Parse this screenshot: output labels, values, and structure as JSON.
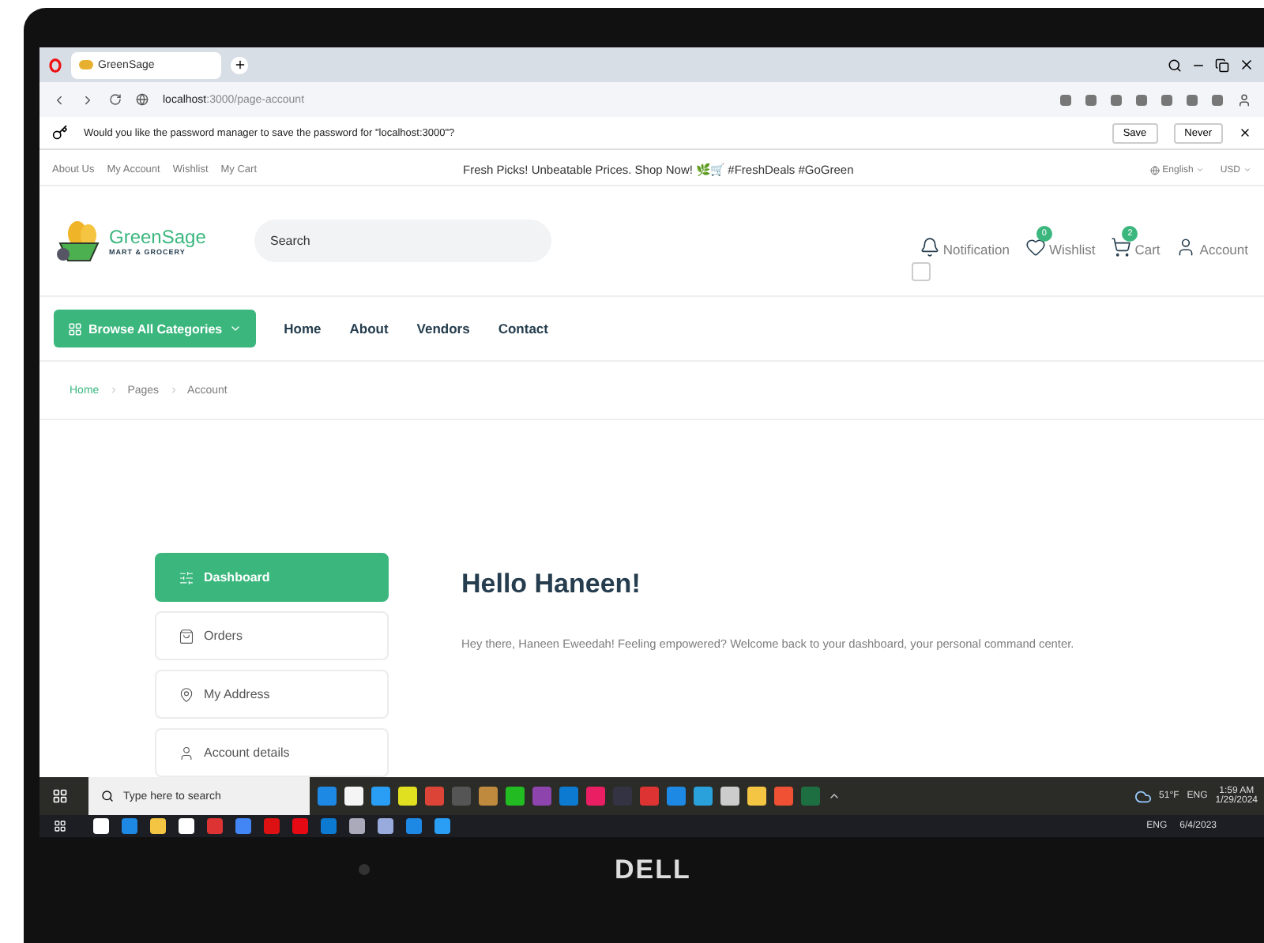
{
  "browser": {
    "tab_title": "GreenSage",
    "address_host": "localhost",
    "address_path": ":3000/page-account"
  },
  "password_prompt": {
    "message": "Would you like the password manager to save the password for \"localhost:3000\"?",
    "buttons": [
      "Save",
      "Never"
    ]
  },
  "topbar": {
    "links": [
      "About Us",
      "My Account",
      "Wishlist",
      "My Cart"
    ],
    "promo": "Fresh Picks! Unbeatable Prices. Shop Now! 🌿🛒 #FreshDeals #GoGreen",
    "language": "English",
    "currency": "USD"
  },
  "header": {
    "brand": "GreenSage",
    "tagline": "MART & GROCERY",
    "search_placeholder": "Search",
    "actions": [
      {
        "kind": "notification",
        "label": "Notification",
        "checked": false
      },
      {
        "kind": "wishlist",
        "label": "Wishlist",
        "count": "0"
      },
      {
        "kind": "cart",
        "label": "Cart",
        "count": "2"
      },
      {
        "kind": "account",
        "label": "Account"
      }
    ]
  },
  "nav": {
    "categories_button": "Browse All Categories",
    "links": [
      "Home",
      "About",
      "Vendors",
      "Contact"
    ]
  },
  "breadcrumb": [
    "Home",
    "Pages",
    "Account"
  ],
  "account_menu": [
    {
      "kind": "dashboard",
      "label": "Dashboard",
      "selected": true
    },
    {
      "kind": "orders",
      "label": "Orders",
      "selected": false
    },
    {
      "kind": "address",
      "label": "My Address",
      "selected": false
    },
    {
      "kind": "details",
      "label": "Account details",
      "selected": false
    }
  ],
  "greeting": {
    "title": "Hello Haneen!",
    "message": "Hey there, Haneen Eweedah! Feeling empowered? Welcome back to your dashboard, your personal command center."
  },
  "taskbar": {
    "search_placeholder": "Type here to search",
    "weather": "51°F",
    "language": "ENG",
    "time": "1:59 AM",
    "date": "1/29/2024"
  },
  "taskbar_behind": {
    "language": "ENG",
    "date": "6/4/2023"
  },
  "laptop": {
    "brand": "DELL"
  }
}
